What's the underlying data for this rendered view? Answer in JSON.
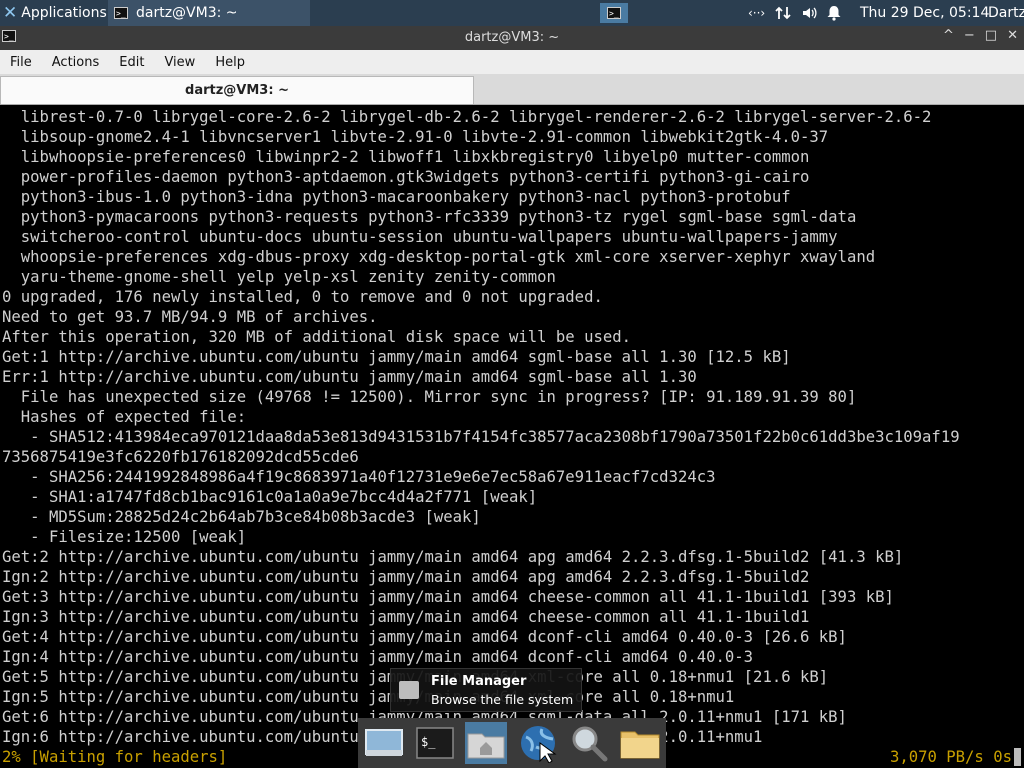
{
  "panel": {
    "applications_label": "Applications",
    "task_title": "dartz@VM3: ~",
    "clock": "Thu 29 Dec, 05:14",
    "user": "Dartz",
    "tray_network": "‹··›"
  },
  "window": {
    "title": "dartz@VM3: ~",
    "controls": {
      "restore": "^",
      "minimize": "−",
      "maximize": "□",
      "close": "✕"
    }
  },
  "menubar": {
    "items": [
      "File",
      "Actions",
      "Edit",
      "View",
      "Help"
    ]
  },
  "tabs": [
    {
      "label": "dartz@VM3: ~"
    }
  ],
  "terminal": {
    "lines": [
      "  librest-0.7-0 librygel-core-2.6-2 librygel-db-2.6-2 librygel-renderer-2.6-2 librygel-server-2.6-2",
      "  libsoup-gnome2.4-1 libvncserver1 libvte-2.91-0 libvte-2.91-common libwebkit2gtk-4.0-37",
      "  libwhoopsie-preferences0 libwinpr2-2 libwoff1 libxkbregistry0 libyelp0 mutter-common",
      "  power-profiles-daemon python3-aptdaemon.gtk3widgets python3-certifi python3-gi-cairo",
      "  python3-ibus-1.0 python3-idna python3-macaroonbakery python3-nacl python3-protobuf",
      "  python3-pymacaroons python3-requests python3-rfc3339 python3-tz rygel sgml-base sgml-data",
      "  switcheroo-control ubuntu-docs ubuntu-session ubuntu-wallpapers ubuntu-wallpapers-jammy",
      "  whoopsie-preferences xdg-dbus-proxy xdg-desktop-portal-gtk xml-core xserver-xephyr xwayland",
      "  yaru-theme-gnome-shell yelp yelp-xsl zenity zenity-common",
      "0 upgraded, 176 newly installed, 0 to remove and 0 not upgraded.",
      "Need to get 93.7 MB/94.9 MB of archives.",
      "After this operation, 320 MB of additional disk space will be used.",
      "Get:1 http://archive.ubuntu.com/ubuntu jammy/main amd64 sgml-base all 1.30 [12.5 kB]",
      "Err:1 http://archive.ubuntu.com/ubuntu jammy/main amd64 sgml-base all 1.30",
      "  File has unexpected size (49768 != 12500). Mirror sync in progress? [IP: 91.189.91.39 80]",
      "  Hashes of expected file:",
      "   - SHA512:413984eca970121daa8da53e813d9431531b7f4154fc38577aca2308bf1790a73501f22b0c61dd3be3c109af19",
      "7356875419e3fc6220fb176182092dcd55cde6",
      "   - SHA256:2441992848986a4f19c8683971a40f12731e9e6e7ec58a67e911eacf7cd324c3",
      "   - SHA1:a1747fd8cb1bac9161c0a1a0a9e7bcc4d4a2f771 [weak]",
      "   - MD5Sum:28825d24c2b64ab7b3ce84b08b3acde3 [weak]",
      "   - Filesize:12500 [weak]",
      "Get:2 http://archive.ubuntu.com/ubuntu jammy/main amd64 apg amd64 2.2.3.dfsg.1-5build2 [41.3 kB]",
      "Ign:2 http://archive.ubuntu.com/ubuntu jammy/main amd64 apg amd64 2.2.3.dfsg.1-5build2",
      "Get:3 http://archive.ubuntu.com/ubuntu jammy/main amd64 cheese-common all 41.1-1build1 [393 kB]",
      "Ign:3 http://archive.ubuntu.com/ubuntu jammy/main amd64 cheese-common all 41.1-1build1",
      "Get:4 http://archive.ubuntu.com/ubuntu jammy/main amd64 dconf-cli amd64 0.40.0-3 [26.6 kB]",
      "Ign:4 http://archive.ubuntu.com/ubuntu jammy/main amd64 dconf-cli amd64 0.40.0-3",
      "Get:5 http://archive.ubuntu.com/ubuntu jammy/main amd64 xml-core all 0.18+nmu1 [21.6 kB]",
      "Ign:5 http://archive.ubuntu.com/ubuntu jammy/main amd64 xml-core all 0.18+nmu1",
      "Get:6 http://archive.ubuntu.com/ubuntu jammy/main amd64 sgml-data all 2.0.11+nmu1 [171 kB]",
      "Ign:6 http://archive.ubuntu.com/ubuntu jammy/main amd64 sgml-data all 2.0.11+nmu1"
    ],
    "status_left": "2% [Waiting for headers]",
    "status_right": "3,070 PB/s 0s"
  },
  "tooltip": {
    "title": "File Manager",
    "description": "Browse the file system"
  },
  "dock": {
    "items": [
      {
        "name": "show-desktop-icon"
      },
      {
        "name": "terminal-icon",
        "glyph": "$_"
      },
      {
        "name": "home-folder-icon"
      },
      {
        "name": "web-browser-icon"
      },
      {
        "name": "search-icon"
      },
      {
        "name": "folder-icon"
      }
    ]
  }
}
